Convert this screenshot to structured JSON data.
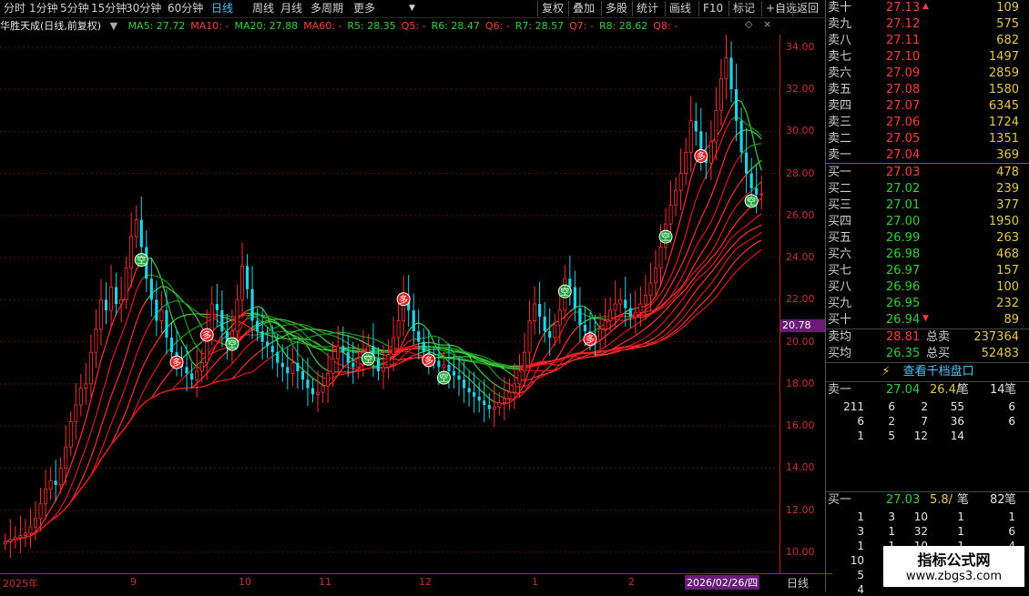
{
  "toolbar": {
    "periods": [
      "分时",
      "1分钟",
      "5分钟",
      "15分钟",
      "30分钟",
      "60分钟",
      "日线",
      "周线",
      "月线",
      "多周期",
      "更多"
    ],
    "active_period": "日线",
    "actions": [
      "复权",
      "叠加",
      "多股",
      "统计",
      "画线",
      "F10",
      "标记",
      "+自选",
      "返回"
    ]
  },
  "legend": {
    "stock": "华胜天成(日线,前复权)",
    "indicators": [
      {
        "label": "MA5: 27.72",
        "color": "#2fd13a"
      },
      {
        "label": "MA10: -",
        "color": "#ff3c3c"
      },
      {
        "label": "MA20: 27.88",
        "color": "#2fd13a"
      },
      {
        "label": "MA60: -",
        "color": "#ff3c3c"
      },
      {
        "label": "R5: 28.35",
        "color": "#2fd13a"
      },
      {
        "label": "Q5: -",
        "color": "#ff3c3c"
      },
      {
        "label": "R6: 28.47",
        "color": "#2fd13a"
      },
      {
        "label": "Q6: -",
        "color": "#ff3c3c"
      },
      {
        "label": "R7: 28.57",
        "color": "#2fd13a"
      },
      {
        "label": "Q7: -",
        "color": "#ff3c3c"
      },
      {
        "label": "R8: 28.62",
        "color": "#2fd13a"
      },
      {
        "label": "Q8: -",
        "color": "#ff3c3c"
      }
    ]
  },
  "chart_data": {
    "type": "candlestick",
    "y_ticks": [
      "34.00",
      "32.00",
      "30.00",
      "28.00",
      "26.00",
      "24.00",
      "22.00",
      "20.00",
      "18.00",
      "16.00",
      "14.00",
      "12.00",
      "10.00"
    ],
    "ylim": [
      9.0,
      34.6
    ],
    "current_price": "20.78",
    "current_price_value": 20.78,
    "x_labels": [
      "2025年",
      "9",
      "10",
      "11",
      "12",
      "1",
      "2"
    ],
    "cursor_date": "2026/02/26/四",
    "period_label": "日线",
    "signals": [
      {
        "label": "多",
        "day": 49
      },
      {
        "label": "空",
        "day": 39
      },
      {
        "label": "多",
        "day": 58
      },
      {
        "label": "空",
        "day": 65
      },
      {
        "label": "空",
        "day": 103
      },
      {
        "label": "多",
        "day": 114
      },
      {
        "label": "多",
        "day": 121
      },
      {
        "label": "空",
        "day": 125
      },
      {
        "label": "空",
        "day": 188
      },
      {
        "label": "多",
        "day": 198
      },
      {
        "label": "多",
        "day": 166
      },
      {
        "label": "空",
        "day": 160
      },
      {
        "label": "空",
        "day": 213
      }
    ],
    "path": [
      10.5,
      10.6,
      10.7,
      10.8,
      10.9,
      11.2,
      11.6,
      12.3,
      13.0,
      13.4,
      13.2,
      14.0,
      15.0,
      16.2,
      17.0,
      17.8,
      18.0,
      19.5,
      20.6,
      22.0,
      21.5,
      22.6,
      21.8,
      22.0,
      23.5,
      25.0,
      25.8,
      24.5,
      23.0,
      22.0,
      21.0,
      21.5,
      20.2,
      19.5,
      19.2,
      18.8,
      18.5,
      18.2,
      18.6,
      19.0,
      20.5,
      21.8,
      21.5,
      20.5,
      19.8,
      20.5,
      22.0,
      23.6,
      22.5,
      21.0,
      20.5,
      20.0,
      19.8,
      19.5,
      19.0,
      18.8,
      18.5,
      19.0,
      18.6,
      18.2,
      17.8,
      17.5,
      17.6,
      17.9,
      18.5,
      19.2,
      19.8,
      19.5,
      19.0,
      18.8,
      19.2,
      19.5,
      19.8,
      19.2,
      18.6,
      18.8,
      19.4,
      20.2,
      21.0,
      22.2,
      21.5,
      20.5,
      20.0,
      19.5,
      19.3,
      19.1,
      18.8,
      18.9,
      18.6,
      18.4,
      18.2,
      17.8,
      17.6,
      17.4,
      17.2,
      17.0,
      16.8,
      16.9,
      17.1,
      17.3,
      17.6,
      18.0,
      18.6,
      19.5,
      21.0,
      21.8,
      21.2,
      20.5,
      20.2,
      20.8,
      21.5,
      23.0,
      22.6,
      21.6,
      20.8,
      20.5,
      20.3,
      20.1,
      20.6,
      21.0,
      21.5,
      21.8,
      22.0,
      21.6,
      21.2,
      21.4,
      21.8,
      22.2,
      22.8,
      23.5,
      24.5,
      25.6,
      26.5,
      27.2,
      28.0,
      29.0,
      30.5,
      30.0,
      29.0,
      28.5,
      29.5,
      31.0,
      32.5,
      33.5,
      32.0,
      30.5,
      29.0,
      28.0,
      27.3,
      27.0,
      27.03
    ],
    "order_book_sell": [
      {
        "label": "卖十",
        "price": "27.13",
        "vol": "109"
      },
      {
        "label": "卖九",
        "price": "27.12",
        "vol": "575"
      },
      {
        "label": "卖八",
        "price": "27.11",
        "vol": "682"
      },
      {
        "label": "卖七",
        "price": "27.10",
        "vol": "1497"
      },
      {
        "label": "卖六",
        "price": "27.09",
        "vol": "2859"
      },
      {
        "label": "卖五",
        "price": "27.08",
        "vol": "1580"
      },
      {
        "label": "卖四",
        "price": "27.07",
        "vol": "6345"
      },
      {
        "label": "卖三",
        "price": "27.06",
        "vol": "1724"
      },
      {
        "label": "卖二",
        "price": "27.05",
        "vol": "1351"
      },
      {
        "label": "卖一",
        "price": "27.04",
        "vol": "369"
      }
    ],
    "order_book_buy": [
      {
        "label": "买一",
        "price": "27.03",
        "vol": "478"
      },
      {
        "label": "买二",
        "price": "27.02",
        "vol": "239"
      },
      {
        "label": "买三",
        "price": "27.01",
        "vol": "377"
      },
      {
        "label": "买四",
        "price": "27.00",
        "vol": "1950"
      },
      {
        "label": "买五",
        "price": "26.99",
        "vol": "263"
      },
      {
        "label": "买六",
        "price": "26.98",
        "vol": "468"
      },
      {
        "label": "买七",
        "price": "26.97",
        "vol": "157"
      },
      {
        "label": "买八",
        "price": "26.96",
        "vol": "100"
      },
      {
        "label": "买九",
        "price": "26.95",
        "vol": "232"
      },
      {
        "label": "买十",
        "price": "26.94",
        "vol": "89"
      }
    ]
  },
  "quote": {
    "sell_avg_label": "卖均",
    "sell_avg": "28.81",
    "total_sell_label": "总卖",
    "total_sell": "237364",
    "buy_avg_label": "买均",
    "buy_avg": "26.35",
    "total_buy_label": "总买",
    "total_buy": "52483",
    "view_1000_button": "查看千档盘口",
    "sell_queue": {
      "label": "卖一",
      "price": "27.04",
      "count": "26.4/",
      "unit": "笔",
      "orders": "14",
      "order_unit": "笔",
      "rows": [
        [
          "211",
          "6",
          "2",
          "55",
          "6"
        ],
        [
          "6",
          "2",
          "7",
          "36",
          "6"
        ],
        [
          "1",
          "5",
          "12",
          "14",
          ""
        ]
      ]
    },
    "buy_queue": {
      "label": "买一",
      "price": "27.03",
      "count": "5.8/",
      "unit": "笔",
      "orders": "82",
      "order_unit": "笔",
      "rows": [
        [
          "1",
          "3",
          "10",
          "1",
          "1"
        ],
        [
          "3",
          "1",
          "32",
          "1",
          "6"
        ],
        [
          "1",
          "1",
          "10",
          "1",
          "4"
        ],
        [
          "10",
          "",
          "",
          "",
          ""
        ],
        [
          "5",
          "",
          "",
          "",
          ""
        ],
        [
          "4",
          "",
          "",
          "",
          ""
        ]
      ]
    }
  },
  "watermark": {
    "title": "指标公式网",
    "url": "www.zbgs3.com"
  }
}
